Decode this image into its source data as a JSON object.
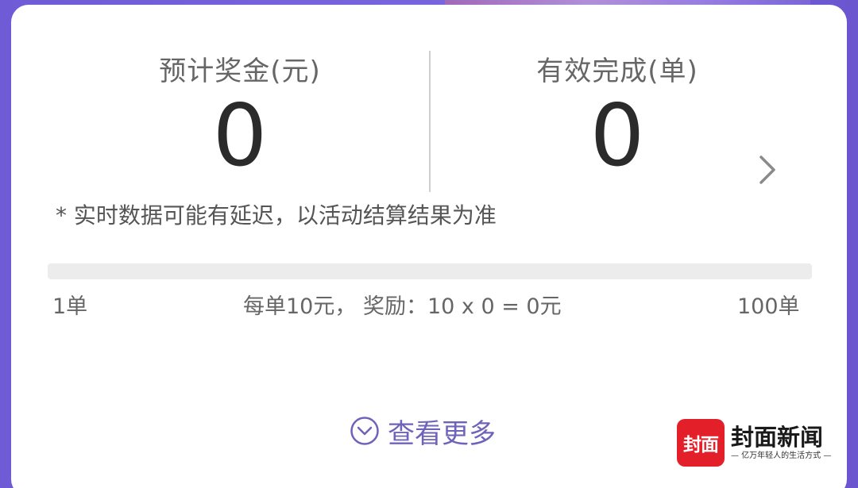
{
  "stats": {
    "bonus_label": "预计奖金(元)",
    "bonus_value": "0",
    "completed_label": "有效完成(单)",
    "completed_value": "0"
  },
  "note": "* 实时数据可能有延迟，以活动结算结果为准",
  "progress": {
    "fraction": 0,
    "min_label": "1单",
    "max_label": "100单",
    "reward_text": "每单10元， 奖励：10 x 0 = 0元"
  },
  "more_label": "查看更多",
  "icons": {
    "detail": "chevron-right-icon",
    "more": "circle-chevron-down-icon"
  },
  "watermark": {
    "badge": "封面",
    "title": "封面新闻",
    "slogan": "— 亿万年轻人的生活方式 —"
  },
  "colors": {
    "background": "#7a67e0",
    "accent": "#6e63b8",
    "brand_red": "#e3202a"
  }
}
